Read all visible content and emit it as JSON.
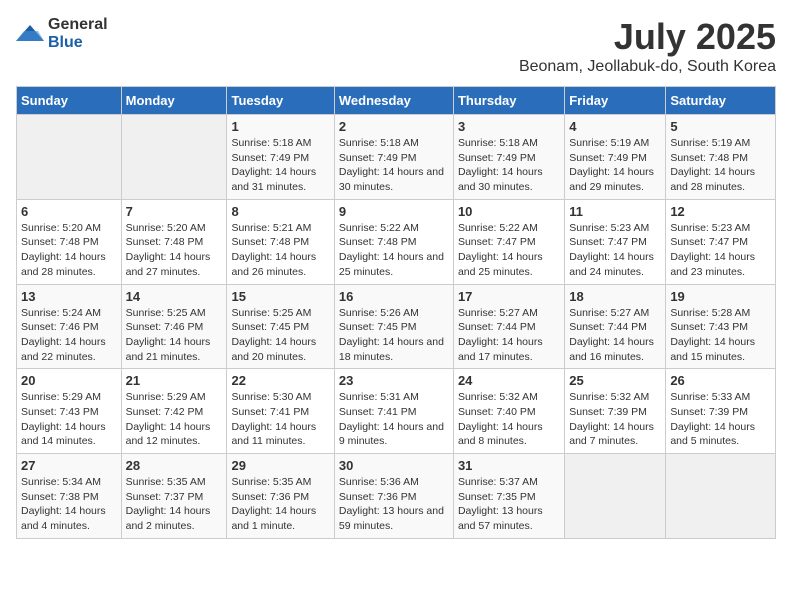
{
  "logo": {
    "general": "General",
    "blue": "Blue"
  },
  "title": "July 2025",
  "subtitle": "Beonam, Jeollabuk-do, South Korea",
  "days_of_week": [
    "Sunday",
    "Monday",
    "Tuesday",
    "Wednesday",
    "Thursday",
    "Friday",
    "Saturday"
  ],
  "weeks": [
    [
      {
        "day": "",
        "info": ""
      },
      {
        "day": "",
        "info": ""
      },
      {
        "day": "1",
        "info": "Sunrise: 5:18 AM\nSunset: 7:49 PM\nDaylight: 14 hours and 31 minutes."
      },
      {
        "day": "2",
        "info": "Sunrise: 5:18 AM\nSunset: 7:49 PM\nDaylight: 14 hours and 30 minutes."
      },
      {
        "day": "3",
        "info": "Sunrise: 5:18 AM\nSunset: 7:49 PM\nDaylight: 14 hours and 30 minutes."
      },
      {
        "day": "4",
        "info": "Sunrise: 5:19 AM\nSunset: 7:49 PM\nDaylight: 14 hours and 29 minutes."
      },
      {
        "day": "5",
        "info": "Sunrise: 5:19 AM\nSunset: 7:48 PM\nDaylight: 14 hours and 28 minutes."
      }
    ],
    [
      {
        "day": "6",
        "info": "Sunrise: 5:20 AM\nSunset: 7:48 PM\nDaylight: 14 hours and 28 minutes."
      },
      {
        "day": "7",
        "info": "Sunrise: 5:20 AM\nSunset: 7:48 PM\nDaylight: 14 hours and 27 minutes."
      },
      {
        "day": "8",
        "info": "Sunrise: 5:21 AM\nSunset: 7:48 PM\nDaylight: 14 hours and 26 minutes."
      },
      {
        "day": "9",
        "info": "Sunrise: 5:22 AM\nSunset: 7:48 PM\nDaylight: 14 hours and 25 minutes."
      },
      {
        "day": "10",
        "info": "Sunrise: 5:22 AM\nSunset: 7:47 PM\nDaylight: 14 hours and 25 minutes."
      },
      {
        "day": "11",
        "info": "Sunrise: 5:23 AM\nSunset: 7:47 PM\nDaylight: 14 hours and 24 minutes."
      },
      {
        "day": "12",
        "info": "Sunrise: 5:23 AM\nSunset: 7:47 PM\nDaylight: 14 hours and 23 minutes."
      }
    ],
    [
      {
        "day": "13",
        "info": "Sunrise: 5:24 AM\nSunset: 7:46 PM\nDaylight: 14 hours and 22 minutes."
      },
      {
        "day": "14",
        "info": "Sunrise: 5:25 AM\nSunset: 7:46 PM\nDaylight: 14 hours and 21 minutes."
      },
      {
        "day": "15",
        "info": "Sunrise: 5:25 AM\nSunset: 7:45 PM\nDaylight: 14 hours and 20 minutes."
      },
      {
        "day": "16",
        "info": "Sunrise: 5:26 AM\nSunset: 7:45 PM\nDaylight: 14 hours and 18 minutes."
      },
      {
        "day": "17",
        "info": "Sunrise: 5:27 AM\nSunset: 7:44 PM\nDaylight: 14 hours and 17 minutes."
      },
      {
        "day": "18",
        "info": "Sunrise: 5:27 AM\nSunset: 7:44 PM\nDaylight: 14 hours and 16 minutes."
      },
      {
        "day": "19",
        "info": "Sunrise: 5:28 AM\nSunset: 7:43 PM\nDaylight: 14 hours and 15 minutes."
      }
    ],
    [
      {
        "day": "20",
        "info": "Sunrise: 5:29 AM\nSunset: 7:43 PM\nDaylight: 14 hours and 14 minutes."
      },
      {
        "day": "21",
        "info": "Sunrise: 5:29 AM\nSunset: 7:42 PM\nDaylight: 14 hours and 12 minutes."
      },
      {
        "day": "22",
        "info": "Sunrise: 5:30 AM\nSunset: 7:41 PM\nDaylight: 14 hours and 11 minutes."
      },
      {
        "day": "23",
        "info": "Sunrise: 5:31 AM\nSunset: 7:41 PM\nDaylight: 14 hours and 9 minutes."
      },
      {
        "day": "24",
        "info": "Sunrise: 5:32 AM\nSunset: 7:40 PM\nDaylight: 14 hours and 8 minutes."
      },
      {
        "day": "25",
        "info": "Sunrise: 5:32 AM\nSunset: 7:39 PM\nDaylight: 14 hours and 7 minutes."
      },
      {
        "day": "26",
        "info": "Sunrise: 5:33 AM\nSunset: 7:39 PM\nDaylight: 14 hours and 5 minutes."
      }
    ],
    [
      {
        "day": "27",
        "info": "Sunrise: 5:34 AM\nSunset: 7:38 PM\nDaylight: 14 hours and 4 minutes."
      },
      {
        "day": "28",
        "info": "Sunrise: 5:35 AM\nSunset: 7:37 PM\nDaylight: 14 hours and 2 minutes."
      },
      {
        "day": "29",
        "info": "Sunrise: 5:35 AM\nSunset: 7:36 PM\nDaylight: 14 hours and 1 minute."
      },
      {
        "day": "30",
        "info": "Sunrise: 5:36 AM\nSunset: 7:36 PM\nDaylight: 13 hours and 59 minutes."
      },
      {
        "day": "31",
        "info": "Sunrise: 5:37 AM\nSunset: 7:35 PM\nDaylight: 13 hours and 57 minutes."
      },
      {
        "day": "",
        "info": ""
      },
      {
        "day": "",
        "info": ""
      }
    ]
  ]
}
